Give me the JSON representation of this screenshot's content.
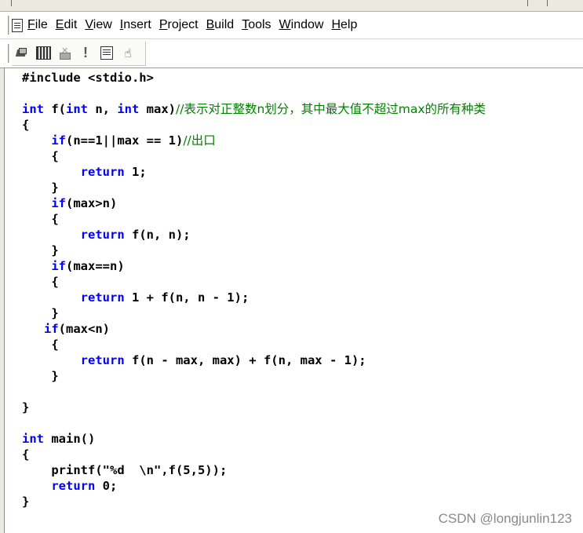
{
  "menu": {
    "items": [
      {
        "id": "file",
        "underline": "F",
        "rest": "ile"
      },
      {
        "id": "edit",
        "underline": "E",
        "rest": "dit"
      },
      {
        "id": "view",
        "underline": "V",
        "rest": "iew"
      },
      {
        "id": "insert",
        "underline": "I",
        "rest": "nsert"
      },
      {
        "id": "project",
        "underline": "P",
        "rest": "roject"
      },
      {
        "id": "build",
        "underline": "B",
        "rest": "uild"
      },
      {
        "id": "tools",
        "underline": "T",
        "rest": "ools"
      },
      {
        "id": "window",
        "underline": "W",
        "rest": "indow"
      },
      {
        "id": "help",
        "underline": "H",
        "rest": "elp"
      }
    ]
  },
  "toolbar": {
    "buttons": [
      {
        "name": "compile-icon"
      },
      {
        "name": "build-icon"
      },
      {
        "name": "stop-build-icon"
      },
      {
        "name": "execute-icon",
        "glyph": "!"
      },
      {
        "name": "insert-breakpoint-icon"
      },
      {
        "name": "go-hand-icon",
        "glyph": "☝"
      }
    ]
  },
  "code_lines": [
    [
      {
        "t": "#include <stdio.h>"
      }
    ],
    [
      {
        "t": ""
      }
    ],
    [
      {
        "t": "int",
        "c": "kw"
      },
      {
        "t": " f("
      },
      {
        "t": "int",
        "c": "kw"
      },
      {
        "t": " n, "
      },
      {
        "t": "int",
        "c": "kw"
      },
      {
        "t": " max)"
      },
      {
        "t": "//表示对正整数n划分，其中最大值不超过max的所有种类",
        "c": "cm"
      }
    ],
    [
      {
        "t": "{"
      }
    ],
    [
      {
        "t": "    "
      },
      {
        "t": "if",
        "c": "kw"
      },
      {
        "t": "(n==1||max == 1)"
      },
      {
        "t": "//出口",
        "c": "cm"
      }
    ],
    [
      {
        "t": "    {"
      }
    ],
    [
      {
        "t": "        "
      },
      {
        "t": "return",
        "c": "kw"
      },
      {
        "t": " 1;"
      }
    ],
    [
      {
        "t": "    }"
      }
    ],
    [
      {
        "t": "    "
      },
      {
        "t": "if",
        "c": "kw"
      },
      {
        "t": "(max>n)"
      }
    ],
    [
      {
        "t": "    {"
      }
    ],
    [
      {
        "t": "        "
      },
      {
        "t": "return",
        "c": "kw"
      },
      {
        "t": " f(n, n);"
      }
    ],
    [
      {
        "t": "    }"
      }
    ],
    [
      {
        "t": "    "
      },
      {
        "t": "if",
        "c": "kw"
      },
      {
        "t": "(max==n)"
      }
    ],
    [
      {
        "t": "    {"
      }
    ],
    [
      {
        "t": "        "
      },
      {
        "t": "return",
        "c": "kw"
      },
      {
        "t": " 1 + f(n, n - 1);"
      }
    ],
    [
      {
        "t": "    }"
      }
    ],
    [
      {
        "t": "   "
      },
      {
        "t": "if",
        "c": "kw"
      },
      {
        "t": "(max<n)"
      }
    ],
    [
      {
        "t": "    {"
      }
    ],
    [
      {
        "t": "        "
      },
      {
        "t": "return",
        "c": "kw"
      },
      {
        "t": " f(n - max, max) + f(n, max - 1);"
      }
    ],
    [
      {
        "t": "    }"
      }
    ],
    [
      {
        "t": ""
      }
    ],
    [
      {
        "t": "}"
      }
    ],
    [
      {
        "t": ""
      }
    ],
    [
      {
        "t": "int",
        "c": "kw"
      },
      {
        "t": " main()"
      }
    ],
    [
      {
        "t": "{"
      }
    ],
    [
      {
        "t": "    printf(\"%d  \\n\",f(5,5));"
      }
    ],
    [
      {
        "t": "    "
      },
      {
        "t": "return",
        "c": "kw"
      },
      {
        "t": " 0;"
      }
    ],
    [
      {
        "t": "}"
      }
    ]
  ],
  "watermark": "CSDN @longjunlin123",
  "colors": {
    "keyword": "#0000ff",
    "comment": "#008000",
    "text": "#000000"
  }
}
